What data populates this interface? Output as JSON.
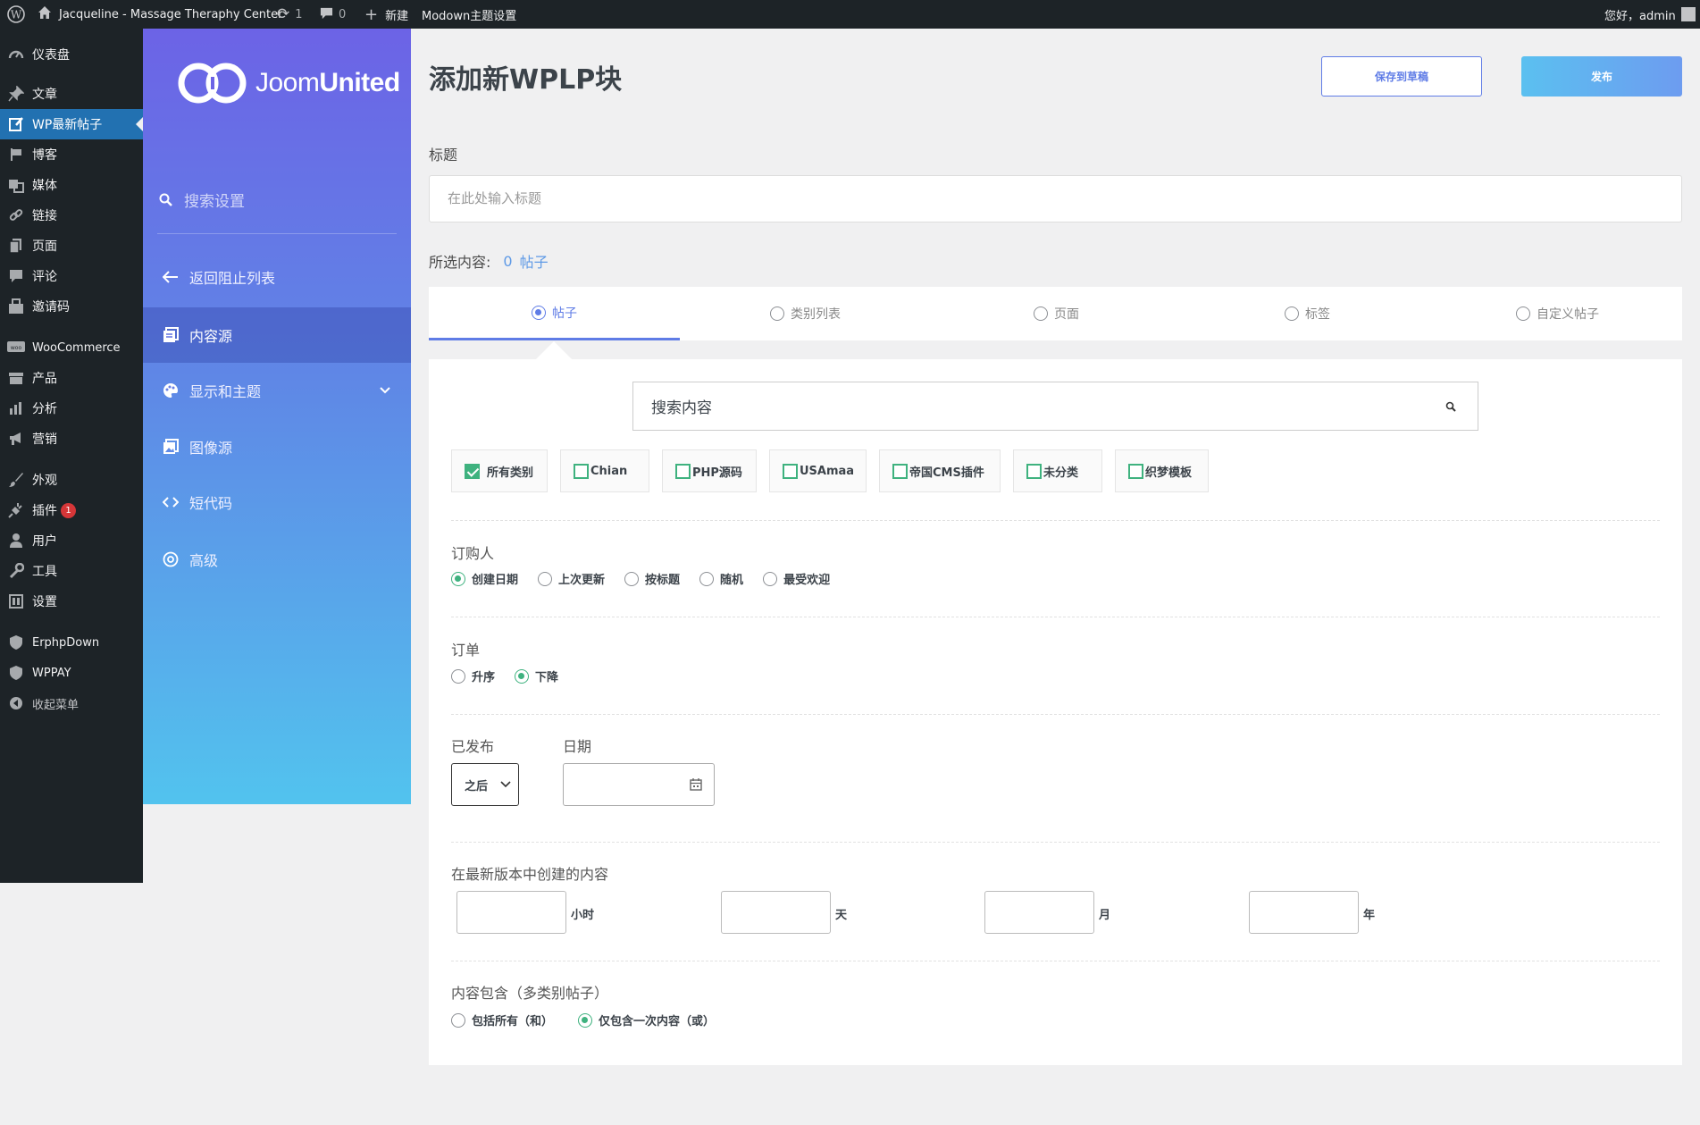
{
  "adminbar": {
    "site_name": "Jacqueline - Massage Theraphy Center",
    "updates_count": "1",
    "comments_count": "0",
    "new_label": "新建",
    "theme_settings": "Modown主题设置",
    "greeting": "您好，admin"
  },
  "wp_menu": {
    "items": [
      {
        "label": "仪表盘",
        "icon": "dashboard-icon"
      },
      {
        "label": "文章",
        "icon": "pin-icon"
      },
      {
        "label": "WP最新帖子",
        "icon": "edit-icon"
      },
      {
        "label": "博客",
        "icon": "flag-icon"
      },
      {
        "label": "媒体",
        "icon": "media-icon"
      },
      {
        "label": "链接",
        "icon": "link-icon"
      },
      {
        "label": "页面",
        "icon": "page-icon"
      },
      {
        "label": "评论",
        "icon": "comment-icon"
      },
      {
        "label": "邀请码",
        "icon": "code-icon"
      },
      {
        "label": "WooCommerce",
        "icon": "woo-icon"
      },
      {
        "label": "产品",
        "icon": "archive-icon"
      },
      {
        "label": "分析",
        "icon": "chart-icon"
      },
      {
        "label": "营销",
        "icon": "megaphone-icon"
      },
      {
        "label": "外观",
        "icon": "brush-icon"
      },
      {
        "label": "插件",
        "icon": "plug-icon",
        "badge": "1"
      },
      {
        "label": "用户",
        "icon": "user-icon"
      },
      {
        "label": "工具",
        "icon": "wrench-icon"
      },
      {
        "label": "设置",
        "icon": "settings-icon"
      },
      {
        "label": "ErphpDown",
        "icon": "shield-icon"
      },
      {
        "label": "WPPAY",
        "icon": "shield-icon"
      },
      {
        "label": "收起菜单",
        "icon": "collapse-icon"
      }
    ]
  },
  "plugin_nav": {
    "logo_light": "Joom",
    "logo_bold": "United",
    "search_placeholder": "搜索设置",
    "back": "返回阻止列表",
    "content_source": "内容源",
    "display_theme": "显示和主题",
    "image_source": "图像源",
    "shortcode": "短代码",
    "advanced": "高级"
  },
  "main": {
    "page_title": "添加新WPLP块",
    "save_draft": "保存到草稿",
    "publish": "发布",
    "title_label": "标题",
    "title_placeholder": "在此处输入标题",
    "selected_label": "所选内容:",
    "selected_count": "0",
    "selected_unit": "帖子",
    "tabs": [
      "帖子",
      "类别列表",
      "页面",
      "标签",
      "自定义帖子"
    ],
    "search_placeholder": "搜索内容",
    "categories": [
      "所有类别",
      "Chian",
      "PHP源码",
      "USAmaa",
      "帝国CMS插件",
      "未分类",
      "织梦模板"
    ],
    "orderby_label": "订购人",
    "orderby_options": [
      "创建日期",
      "上次更新",
      "按标题",
      "随机",
      "最受欢迎"
    ],
    "order_label": "订单",
    "order_options": [
      "升序",
      "下降"
    ],
    "published_label": "已发布",
    "date_label": "日期",
    "published_value": "之后",
    "latest_label": "在最新版本中创建的内容",
    "units": [
      "小时",
      "天",
      "月",
      "年"
    ],
    "contains_label": "内容包含（多类别帖子）",
    "contains_options": [
      "包括所有（和）",
      "仅包含一次内容（或）"
    ]
  }
}
